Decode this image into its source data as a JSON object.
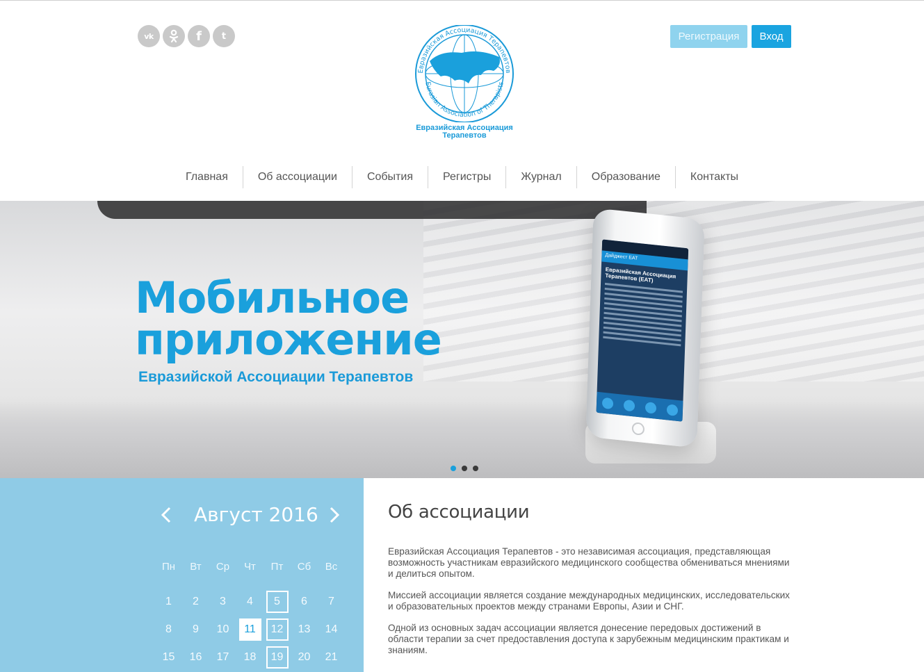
{
  "social": [
    {
      "name": "vk",
      "glyph": "vk"
    },
    {
      "name": "odnoklassniki",
      "glyph": "ok"
    },
    {
      "name": "facebook",
      "glyph": "f"
    },
    {
      "name": "twitter",
      "glyph": "t"
    }
  ],
  "auth": {
    "register": "Регистрация",
    "login": "Вход"
  },
  "logo": {
    "caption_line1": "Евразийская Ассоциация",
    "caption_line2": "Терапевтов",
    "ring_ru": "Евразийская Ассоциация Терапевтов",
    "ring_en": "Eurasian Association of Therapists"
  },
  "nav": [
    "Главная",
    "Об ассоциации",
    "События",
    "Регистры",
    "Журнал",
    "Образование",
    "Контакты"
  ],
  "hero": {
    "title_line1": "Мобильное",
    "title_line2": "приложение",
    "subtitle": "Евразийской Ассоциации Терапевтов",
    "slides": 3,
    "active_slide": 1,
    "phone": {
      "header": "Дайджест ЕАТ",
      "title": "Евразийская Ассоциация Терапевтов (ЕАТ)"
    }
  },
  "calendar": {
    "month": "Август 2016",
    "weekdays": [
      "Пн",
      "Вт",
      "Ср",
      "Чт",
      "Пт",
      "Сб",
      "Вс"
    ],
    "weeks": [
      [
        "1",
        "2",
        "3",
        "4",
        "5",
        "6",
        "7"
      ],
      [
        "8",
        "9",
        "10",
        "11",
        "12",
        "13",
        "14"
      ],
      [
        "15",
        "16",
        "17",
        "18",
        "19",
        "20",
        "21"
      ]
    ],
    "today": "11",
    "event_days": [
      "5",
      "12",
      "19"
    ]
  },
  "about": {
    "title": "Об ассоциации",
    "paragraphs": [
      "Евразийская Ассоциация Терапевтов - это независимая ассоциация, представляющая возможность участникам евразийского медицинского сообщества обмениваться мнениями и делиться опытом.",
      "Миссией ассоциации является создание международных медицинских, исследовательских и образовательных проектов между странами Европы, Азии и СНГ.",
      "Одной из основных задач ассоциации является донесение передовых достижений в области терапии за счет предоставления доступа к зарубежным медицинским практикам и знаниям."
    ]
  },
  "colors": {
    "accent": "#1aa0dc",
    "calendar_bg": "#8fcbe6",
    "register_btn": "#8fd3ee",
    "login_btn": "#1aa4e0"
  }
}
